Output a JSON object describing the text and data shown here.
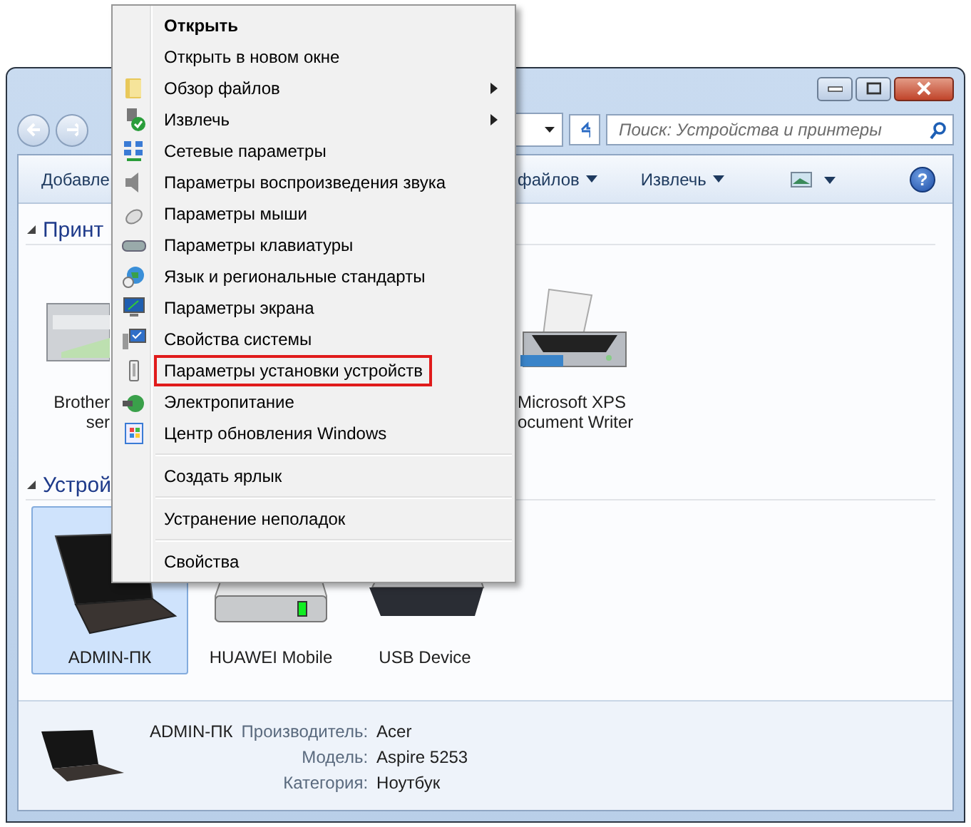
{
  "search": {
    "placeholder": "Поиск: Устройства и принтеры"
  },
  "help_button": {
    "label": "?"
  },
  "toolbar": [
    {
      "label": "Добавле",
      "dropdown": false
    },
    {
      "label": "файлов",
      "dropdown": true
    },
    {
      "label": "Извлечь",
      "dropdown": true
    }
  ],
  "groups": [
    {
      "title": "Принт",
      "items": [
        {
          "kind": "mfp",
          "lines": [
            "Brother",
            "ser"
          ],
          "selected": false
        },
        {
          "kind": "printer",
          "lines": [
            "Microsoft XPS",
            "ocument Writer"
          ],
          "selected": false
        }
      ]
    },
    {
      "title": "Устрой",
      "items": [
        {
          "kind": "laptop",
          "lines": [
            "ADMIN-ПК"
          ],
          "selected": true
        },
        {
          "kind": "drive",
          "lines": [
            "HUAWEI Mobile"
          ],
          "selected": false
        },
        {
          "kind": "keyboard",
          "lines": [
            "USB Device"
          ],
          "selected": false
        }
      ]
    }
  ],
  "details": {
    "name": "ADMIN-ПК",
    "properties": [
      {
        "label": "Производитель:",
        "value": "Acer"
      },
      {
        "label": "Модель:",
        "value": "Aspire 5253"
      },
      {
        "label": "Категория:",
        "value": "Ноутбук"
      }
    ]
  },
  "context_menu": {
    "groups": [
      [
        {
          "label": "Открыть",
          "default": true,
          "submenu": false,
          "highlighted": false
        },
        {
          "label": "Открыть в новом окне",
          "default": false,
          "submenu": false,
          "highlighted": false
        },
        {
          "label": "Обзор файлов",
          "default": false,
          "submenu": true,
          "highlighted": false
        },
        {
          "label": "Извлечь",
          "default": false,
          "submenu": true,
          "highlighted": false
        },
        {
          "label": "Сетевые параметры",
          "default": false,
          "submenu": false,
          "highlighted": false
        },
        {
          "label": "Параметры воспроизведения звука",
          "default": false,
          "submenu": false,
          "highlighted": false
        },
        {
          "label": "Параметры мыши",
          "default": false,
          "submenu": false,
          "highlighted": false
        },
        {
          "label": "Параметры клавиатуры",
          "default": false,
          "submenu": false,
          "highlighted": false
        },
        {
          "label": "Язык и региональные стандарты",
          "default": false,
          "submenu": false,
          "highlighted": false
        },
        {
          "label": "Параметры экрана",
          "default": false,
          "submenu": false,
          "highlighted": false
        },
        {
          "label": "Свойства системы",
          "default": false,
          "submenu": false,
          "highlighted": false
        },
        {
          "label": "Параметры установки устройств",
          "default": false,
          "submenu": false,
          "highlighted": true
        },
        {
          "label": "Электропитание",
          "default": false,
          "submenu": false,
          "highlighted": false
        },
        {
          "label": "Центр обновления Windows",
          "default": false,
          "submenu": false,
          "highlighted": false
        }
      ],
      [
        {
          "label": "Создать ярлык",
          "default": false,
          "submenu": false,
          "highlighted": false
        }
      ],
      [
        {
          "label": "Устранение неполадок",
          "default": false,
          "submenu": false,
          "highlighted": false
        }
      ],
      [
        {
          "label": "Свойства",
          "default": false,
          "submenu": false,
          "highlighted": false
        }
      ]
    ]
  }
}
